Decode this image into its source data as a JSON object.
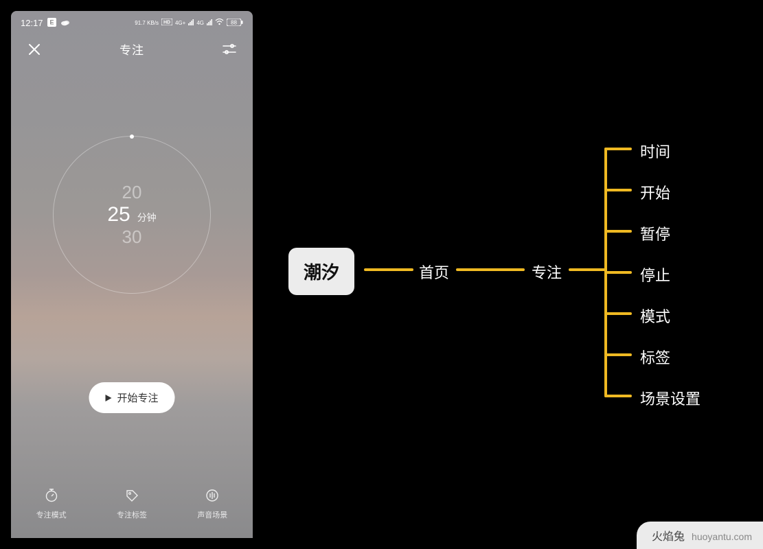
{
  "phone": {
    "statusbar": {
      "time": "12:17",
      "net_speed": "91.7 KB/s",
      "hd_label": "HD",
      "signal1": "4G+",
      "signal2": "4G",
      "battery": "88"
    },
    "header": {
      "title": "专注"
    },
    "dial": {
      "prev": "20",
      "current": "25",
      "unit": "分钟",
      "next": "30"
    },
    "start_button": "开始专注",
    "tabs": {
      "mode": "专注模式",
      "tag": "专注标签",
      "scene": "声音场景"
    }
  },
  "mindmap": {
    "root": "潮汐",
    "mid1": "首页",
    "mid2": "专注",
    "leaves": [
      "时间",
      "开始",
      "暂停",
      "停止",
      "模式",
      "标签",
      "场景设置"
    ],
    "accent_color": "#efb922"
  },
  "watermark": {
    "name": "火焰兔",
    "url": "huoyantu.com"
  }
}
